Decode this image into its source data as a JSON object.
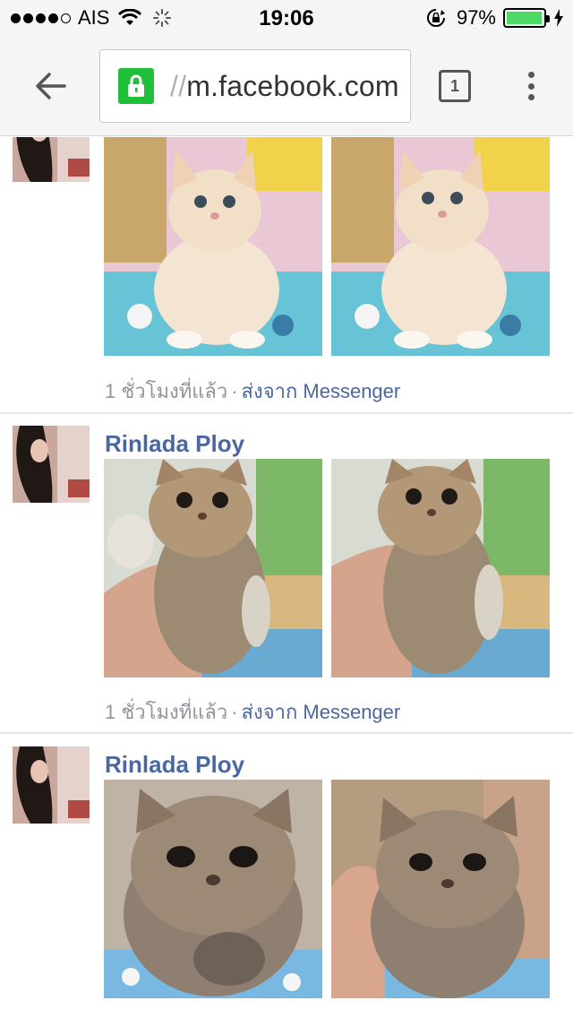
{
  "status_bar": {
    "carrier": "AIS",
    "time": "19:06",
    "battery_percent": "97%",
    "signal_bars_filled": 4,
    "signal_bars_total": 5,
    "battery_level": 0.97
  },
  "browser": {
    "url_scheme": "//",
    "url_host": "m.facebook.com",
    "tab_count": "1",
    "secure_color": "#1fbf3a"
  },
  "colors": {
    "link": "#4b67a1",
    "meta": "#90949c"
  },
  "posts": [
    {
      "author": "",
      "time": "1 ชั่วโมงที่แล้ว",
      "separator": "·",
      "via": "ส่งจาก Messenger",
      "photos": [
        "cream-kitten-photo",
        "cream-kitten-photo"
      ]
    },
    {
      "author": "Rinlada Ploy",
      "time": "1 ชั่วโมงที่แล้ว",
      "separator": "·",
      "via": "ส่งจาก Messenger",
      "photos": [
        "tabby-kitten-held-photo",
        "tabby-kitten-held-photo"
      ]
    },
    {
      "author": "Rinlada Ploy",
      "time": "",
      "separator": "",
      "via": "",
      "photos": [
        "tabby-kitten-closeup-photo",
        "tabby-kitten-closeup-photo"
      ]
    }
  ]
}
